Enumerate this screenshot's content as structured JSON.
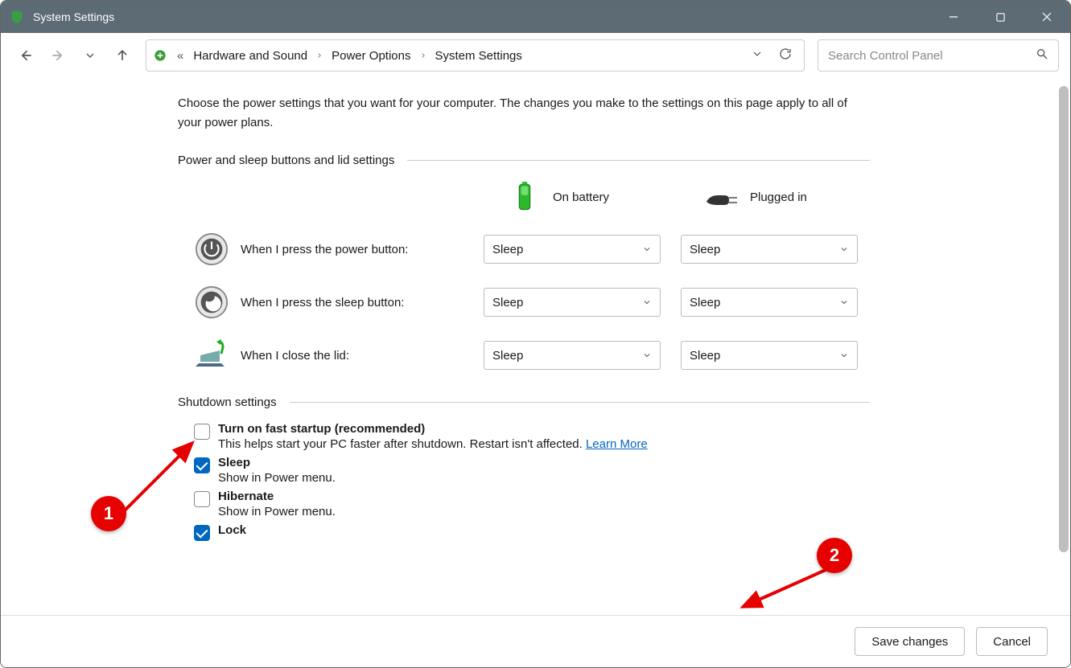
{
  "titlebar": {
    "title": "System Settings"
  },
  "breadcrumb": {
    "items": [
      "Hardware and Sound",
      "Power Options",
      "System Settings"
    ]
  },
  "search": {
    "placeholder": "Search Control Panel"
  },
  "intro": "Choose the power settings that you want for your computer. The changes you make to the settings on this page apply to all of your power plans.",
  "section1": {
    "header": "Power and sleep buttons and lid settings",
    "col_battery": "On battery",
    "col_plugged": "Plugged in",
    "rows": [
      {
        "label": "When I press the power button:",
        "battery": "Sleep",
        "plugged": "Sleep"
      },
      {
        "label": "When I press the sleep button:",
        "battery": "Sleep",
        "plugged": "Sleep"
      },
      {
        "label": "When I close the lid:",
        "battery": "Sleep",
        "plugged": "Sleep"
      }
    ]
  },
  "section2": {
    "header": "Shutdown settings",
    "items": [
      {
        "title": "Turn on fast startup (recommended)",
        "desc": "This helps start your PC faster after shutdown. Restart isn't affected. ",
        "link": "Learn More",
        "checked": false
      },
      {
        "title": "Sleep",
        "desc": "Show in Power menu.",
        "checked": true
      },
      {
        "title": "Hibernate",
        "desc": "Show in Power menu.",
        "checked": false
      },
      {
        "title": "Lock",
        "desc": "",
        "checked": true
      }
    ]
  },
  "buttons": {
    "save": "Save changes",
    "cancel": "Cancel"
  },
  "annotations": {
    "b1": "1",
    "b2": "2"
  }
}
